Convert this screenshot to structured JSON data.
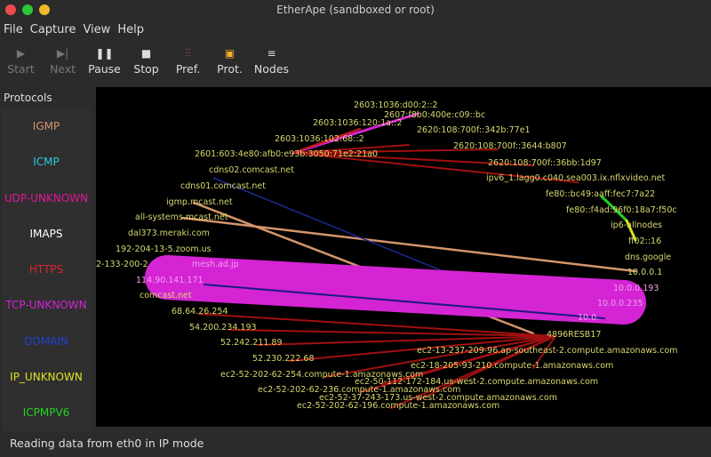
{
  "window": {
    "title": "EtherApe (sandboxed or root)",
    "controls": {
      "close": "#ee4b4b",
      "maximize": "#2ec43a",
      "minimize": "#f0b92a"
    }
  },
  "menu": [
    "File",
    "Capture",
    "View",
    "Help"
  ],
  "toolbar": [
    {
      "label": "Start",
      "icon": "play-icon",
      "enabled": false
    },
    {
      "label": "Next",
      "icon": "skip-next-icon",
      "enabled": false
    },
    {
      "label": "Pause",
      "icon": "pause-icon",
      "enabled": true
    },
    {
      "label": "Stop",
      "icon": "stop-icon",
      "enabled": true
    },
    {
      "label": "Pref.",
      "icon": "sliders-icon",
      "enabled": true
    },
    {
      "label": "Prot.",
      "icon": "protocols-icon",
      "enabled": true
    },
    {
      "label": "Nodes",
      "icon": "nodes-list-icon",
      "enabled": true
    }
  ],
  "sidebar": {
    "title": "Protocols",
    "protocols": [
      {
        "name": "IGMP",
        "color": "#d4956a"
      },
      {
        "name": "ICMP",
        "color": "#2ac9d9"
      },
      {
        "name": "UDP-UNKNOWN",
        "color": "#e0189a"
      },
      {
        "name": "IMAPS",
        "color": "#ffffff"
      },
      {
        "name": "HTTPS",
        "color": "#e02424"
      },
      {
        "name": "TCP-UNKNOWN",
        "color": "#d424d4"
      },
      {
        "name": "DOMAIN",
        "color": "#2040d8"
      },
      {
        "name": "IP_UNKNOWN",
        "color": "#e0e020"
      },
      {
        "name": "ICPMPV6",
        "color": "#24d024"
      }
    ]
  },
  "nodes": [
    "2603:1036:d00:2::2",
    "2607:f8b0:400e:c09::bc",
    "2603:1036:120:1a::2",
    "2620:108:700f::342b:77e1",
    "2603:1036:102:68::2",
    "2620:108:700f::3644:b807",
    "2601:603:4e80:afb0:e93b:3050:71e2:21a0",
    "2620:108:700f::36bb:1d97",
    "cdns02.comcast.net",
    "ipv6_1.lagg0.c040.sea003.ix.nflxvideo.net",
    "cdns01.comcast.net",
    "fe80::bc49:aaff:fec7:7a22",
    "igmp.mcast.net",
    "fe80::f4ad:96f0:18a7:f50c",
    "all-systems.mcast.net",
    "ip6-allnodes",
    "dal373.meraki.com",
    "ff02::16",
    "192-204-13-5.zoom.us",
    "dns.google",
    "2-133-200-2",
    "mesh.ad.jp",
    "10.0.0.1",
    "114.90.141.171",
    "10.0.0.193",
    "comcast.net",
    "10.0.0.235",
    "68.64.26.254",
    "10.0.",
    "4896RESB17",
    "54.200.234.193",
    "ec2-13-237-209-96.ap-southeast-2.compute.amazonaws.com",
    "52.242.211.89",
    "ec2-18-205-93-210.compute-1.amazonaws.com",
    "52.230.222.68",
    "ec2-52-202-62-254.compute-1.amazonaws.com",
    "ec2-50-112-172-184.us-west-2.compute.amazonaws.com",
    "ec2-52-202-62-236.compute-1.amazonaws.com",
    "ec2-52-37-243-173.us-west-2.compute.amazonaws.com",
    "ec2-52-202-62-196.compute-1.amazonaws.com"
  ],
  "status": "Reading data from eth0 in IP mode"
}
